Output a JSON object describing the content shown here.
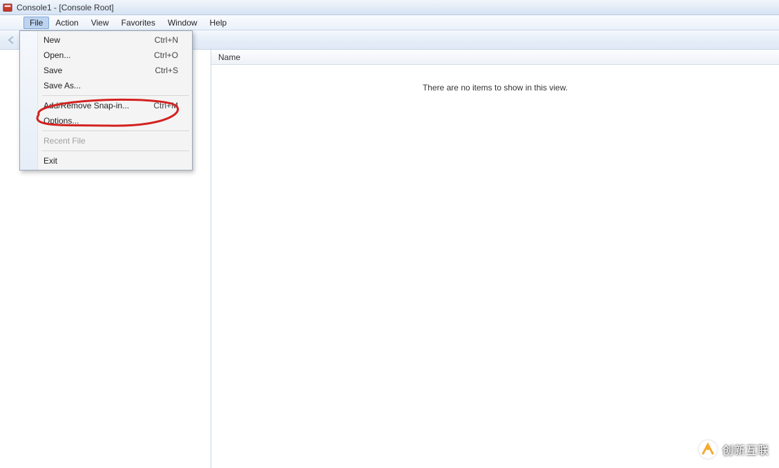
{
  "window": {
    "title": "Console1 - [Console Root]"
  },
  "menubar": {
    "items": [
      "File",
      "Action",
      "View",
      "Favorites",
      "Window",
      "Help"
    ],
    "active_index": 0
  },
  "file_menu": {
    "items": [
      {
        "label": "New",
        "shortcut": "Ctrl+N",
        "enabled": true,
        "sep_after": false
      },
      {
        "label": "Open...",
        "shortcut": "Ctrl+O",
        "enabled": true,
        "sep_after": false
      },
      {
        "label": "Save",
        "shortcut": "Ctrl+S",
        "enabled": true,
        "sep_after": false
      },
      {
        "label": "Save As...",
        "shortcut": "",
        "enabled": true,
        "sep_after": true
      },
      {
        "label": "Add/Remove Snap-in...",
        "shortcut": "Ctrl+M",
        "enabled": true,
        "sep_after": false
      },
      {
        "label": "Options...",
        "shortcut": "",
        "enabled": true,
        "sep_after": true
      },
      {
        "label": "Recent File",
        "shortcut": "",
        "enabled": false,
        "sep_after": true
      },
      {
        "label": "Exit",
        "shortcut": "",
        "enabled": true,
        "sep_after": false
      }
    ]
  },
  "main_pane": {
    "column_header": "Name",
    "empty_message": "There are no items to show in this view."
  },
  "watermark": {
    "text": "创新互联"
  }
}
